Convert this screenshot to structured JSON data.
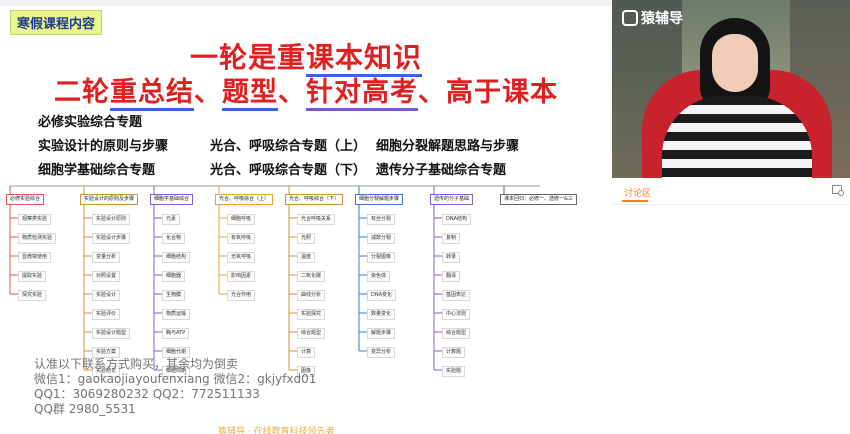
{
  "slide": {
    "label": "寒假课程内容",
    "title_line1": {
      "a": "一轮是重",
      "b": "课本知识"
    },
    "title_line2": {
      "a": "二轮",
      "b": "重总结",
      "c": "、",
      "d": "题型",
      "e": "、",
      "f": "针对高考",
      "g": "、高于课本"
    },
    "topics": [
      "必修实验综合专题",
      "实验设计的原则与步骤",
      "光合、呼吸综合专题（上）",
      "细胞分裂解题思路与步骤",
      "细胞学基础综合专题",
      "光合、呼吸综合专题（下）",
      "遗传分子基础综合专题"
    ]
  },
  "mindmap": {
    "columns": [
      {
        "header": "必修实验综合",
        "color": "#e05555",
        "items": [
          "观察类实验",
          "物质检测实验",
          "显微镜使用",
          "提取实验",
          "探究实验"
        ]
      },
      {
        "header": "实验设计的原则及步骤",
        "color": "#d2913f",
        "items": [
          "实验设计原则",
          "实验设计步骤",
          "变量分析",
          "对照设置",
          "实验设计",
          "实验评价",
          "实验设计题型",
          "实验方案",
          "实验结论"
        ]
      },
      {
        "header": "细胞学基础综合",
        "color": "#8a5cd6",
        "items": [
          "元素",
          "化合物",
          "细胞结构",
          "细胞器",
          "生物膜",
          "物质运输",
          "酶与ATP",
          "细胞代谢",
          "细胞周期"
        ]
      },
      {
        "header": "光合、呼吸综合（上）",
        "color": "#e8a23a",
        "items": [
          "细胞呼吸",
          "有氧呼吸",
          "无氧呼吸",
          "影响因素",
          "光合作用"
        ]
      },
      {
        "header": "光合、呼吸综合（下）",
        "color": "#d2913f",
        "items": [
          "光合呼吸关系",
          "光照",
          "温度",
          "二氧化碳",
          "曲线分析",
          "实验探究",
          "综合题型",
          "计算",
          "图像"
        ]
      },
      {
        "header": "细胞分裂解题步骤",
        "color": "#3c7ad6",
        "items": [
          "有丝分裂",
          "减数分裂",
          "分裂图像",
          "染色体",
          "DNA变化",
          "数量变化",
          "解题步骤",
          "变异分析"
        ]
      },
      {
        "header": "遗传的分子基础",
        "color": "#8a5cd6",
        "items": [
          "DNA结构",
          "复制",
          "转录",
          "翻译",
          "基因表达",
          "中心法则",
          "综合题型",
          "计算题",
          "实验题"
        ]
      },
      {
        "header": "课本回归：必修一、选修一&三",
        "color": "#666666",
        "items": []
      }
    ]
  },
  "watermark": {
    "line1": "认准以下联系方式购买，其余均为倒卖",
    "line2": "微信1：gaokaojiayoufenxiang 微信2：gkjyfxd01",
    "line3": "QQ1：3069280232 QQ2：772511133",
    "line4": "QQ群 2980_5531"
  },
  "bottom_banner": "猿辅导 · 在线教育科技领先者",
  "brand": {
    "name": "猿辅导"
  },
  "panel": {
    "tab_label": "讨论区",
    "icon": "chat-settings-icon"
  }
}
